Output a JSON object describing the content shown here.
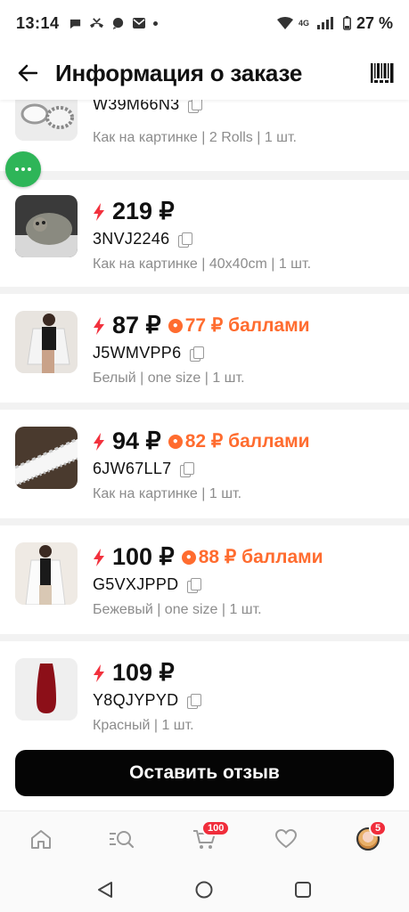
{
  "status_bar": {
    "time": "13:14",
    "battery": "27 %",
    "left_icons": [
      "chat-bubble-icon",
      "missed-call-icon",
      "message-icon",
      "mail-icon"
    ],
    "right_icons": [
      "wifi-icon",
      "volte-icon",
      "signal-icon",
      "battery-icon"
    ]
  },
  "header": {
    "title": "Информация о заказе",
    "back_icon": "arrow-left-icon",
    "barcode_icon": "barcode-icon"
  },
  "colors": {
    "accent_green": "#2eb558",
    "points_orange": "#ff6c2f",
    "bolt_red": "#f2313d",
    "badge_red": "#f02d3b",
    "button_black": "#050505"
  },
  "items": [
    {
      "price": "",
      "sku": "W39M66N3",
      "variant": "Как на картинке | 2 Rolls | 1 шт.",
      "points": null
    },
    {
      "price": "219 ₽",
      "sku": "3NVJ2246",
      "variant": "Как на картинке | 40x40cm | 1 шт.",
      "points": null
    },
    {
      "price": "87 ₽",
      "sku": "J5WMVPP6",
      "variant": "Белый | one size | 1 шт.",
      "points": "77 ₽ баллами"
    },
    {
      "price": "94 ₽",
      "sku": "6JW67LL7",
      "variant": "Как на картинке | 1 шт.",
      "points": "82 ₽ баллами"
    },
    {
      "price": "100 ₽",
      "sku": "G5VXJPPD",
      "variant": "Бежевый | one size | 1 шт.",
      "points": "88 ₽ баллами"
    },
    {
      "price": "109 ₽",
      "sku": "Y8QJYPYD",
      "variant": "Красный | 1 шт.",
      "points": null
    }
  ],
  "review_button": "Оставить отзыв",
  "bottom_nav": {
    "items": [
      "home-icon",
      "catalog-search-icon",
      "cart-icon",
      "favorites-heart-icon",
      "profile-avatar"
    ],
    "cart_badge": "100",
    "profile_badge": "5"
  },
  "system_nav": [
    "back-triangle-icon",
    "home-circle-icon",
    "recents-square-icon"
  ]
}
